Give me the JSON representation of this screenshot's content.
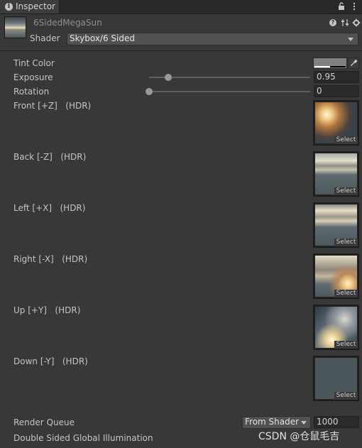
{
  "tab": {
    "label": "Inspector"
  },
  "header": {
    "asset_name": "6SidedMegaSun",
    "shader_label": "Shader",
    "shader_value": "Skybox/6 Sided"
  },
  "properties": {
    "tint": {
      "label": "Tint Color",
      "color": "#818181"
    },
    "exposure": {
      "label": "Exposure",
      "value": "0.95",
      "slider_fraction": 0.12
    },
    "rotation": {
      "label": "Rotation",
      "value": "0",
      "slider_fraction": 0.0
    },
    "textures": [
      {
        "name": "Front [+Z]",
        "tag": "(HDR)",
        "select": "Select"
      },
      {
        "name": "Back [-Z]",
        "tag": "(HDR)",
        "select": "Select"
      },
      {
        "name": "Left [+X]",
        "tag": "(HDR)",
        "select": "Select"
      },
      {
        "name": "Right [-X]",
        "tag": "(HDR)",
        "select": "Select"
      },
      {
        "name": "Up [+Y]",
        "tag": "(HDR)",
        "select": "Select"
      },
      {
        "name": "Down [-Y]",
        "tag": "(HDR)",
        "select": "Select"
      }
    ],
    "render_queue": {
      "label": "Render Queue",
      "mode": "From Shader",
      "value": "1000"
    },
    "double_sided_gi": {
      "label": "Double Sided Global Illumination"
    }
  },
  "watermark": "CSDN @仓鼠毛吉"
}
